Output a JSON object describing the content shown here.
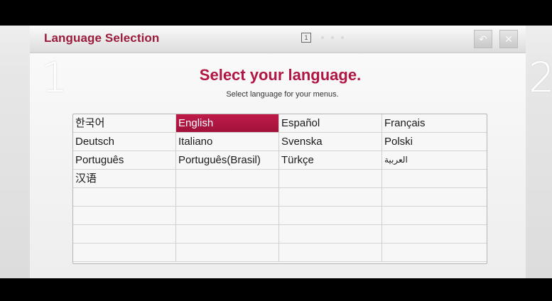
{
  "window": {
    "title": "Language Selection",
    "current_step": "1",
    "next_step": "2",
    "step_indicator": "1",
    "back_icon": "back-arrow-icon",
    "close_icon": "close-icon"
  },
  "prompt": {
    "heading": "Select your language.",
    "subheading": "Select language for your menus."
  },
  "languages": [
    {
      "label": "한국어",
      "selected": false
    },
    {
      "label": "English",
      "selected": true
    },
    {
      "label": "Español",
      "selected": false
    },
    {
      "label": "Français",
      "selected": false
    },
    {
      "label": "Deutsch",
      "selected": false
    },
    {
      "label": "Italiano",
      "selected": false
    },
    {
      "label": "Svenska",
      "selected": false
    },
    {
      "label": "Polski",
      "selected": false
    },
    {
      "label": "Português",
      "selected": false
    },
    {
      "label": "Português(Brasil)",
      "selected": false
    },
    {
      "label": "Türkçe",
      "selected": false
    },
    {
      "label": "العربية",
      "selected": false
    },
    {
      "label": "汉语",
      "selected": false
    }
  ],
  "colors": {
    "accent": "#b01543",
    "selection": "#b2163f"
  }
}
